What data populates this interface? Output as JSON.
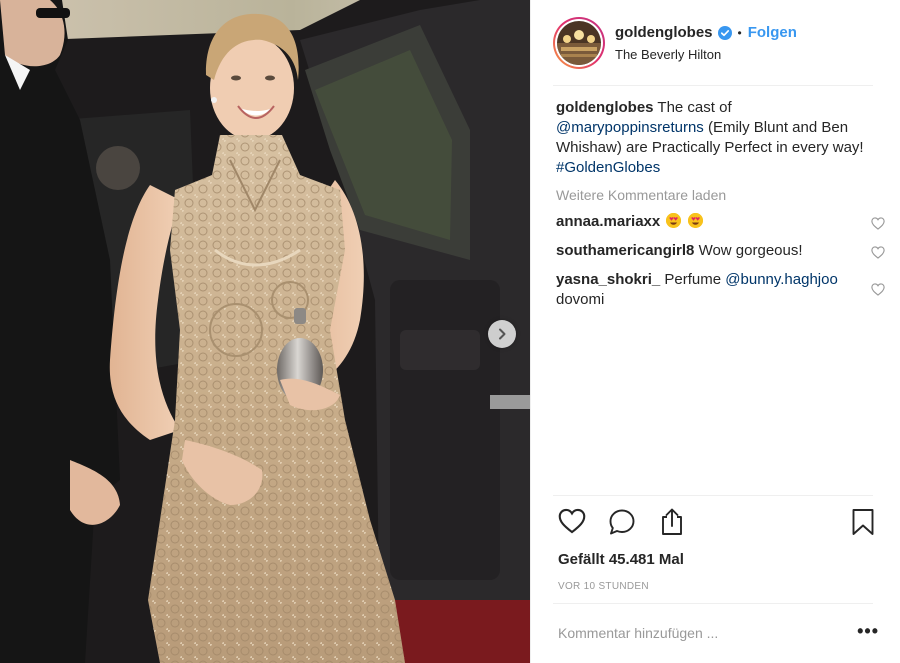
{
  "post": {
    "photo_icon": "photo-of-woman-in-embellished-gown-exiting-car",
    "next_icon": "chevron-right-icon"
  },
  "header": {
    "username": "goldenglobes",
    "verified_icon": "verified-badge-icon",
    "separator": "•",
    "follow_label": "Folgen",
    "location": "The Beverly Hilton"
  },
  "caption": {
    "username": "goldenglobes",
    "text_1": "The cast of",
    "mention": "@marypoppinsreturns",
    "text_2": "(Emily Blunt and Ben Whishaw) are Practically Perfect in every way!",
    "hashtag": "#GoldenGlobes"
  },
  "load_more_label": "Weitere Kommentare laden",
  "comments": [
    {
      "username": "annaa.mariaxx",
      "text": "",
      "emojis": "heart-eyes-emoji heart-eyes-emoji"
    },
    {
      "username": "southamericangirl8",
      "text": "Wow gorgeous!"
    },
    {
      "username": "yasna_shokri_",
      "text_1": "Perfume",
      "mention": "@bunny.haghjoo",
      "text_2": "dovomi"
    }
  ],
  "actions": {
    "like_icon": "heart-icon",
    "comment_icon": "comment-bubble-icon",
    "share_icon": "share-icon",
    "save_icon": "bookmark-icon"
  },
  "likes": "Gefällt 45.481 Mal",
  "timestamp": "VOR 10 STUNDEN",
  "add_comment": {
    "placeholder": "Kommentar hinzufügen ...",
    "more_label": "•••"
  },
  "colors": {
    "link": "#003569",
    "follow": "#3897f0",
    "muted": "#999999",
    "text": "#262626",
    "divider": "#efefef"
  }
}
